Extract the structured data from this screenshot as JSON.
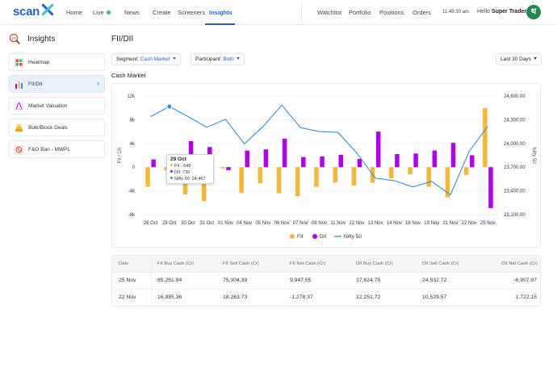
{
  "nav": {
    "logo": "scan",
    "items": [
      "Home",
      "Live",
      "News",
      "Create",
      "Screeners",
      "Insights"
    ],
    "right_items": [
      "Watchlist",
      "Portfolio",
      "Positions",
      "Orders"
    ],
    "time": "11:49:30 am",
    "hello_prefix": "Hello",
    "user_name": "Super Trader",
    "avatar_letter": "थ",
    "accent_color": "#1f62d6",
    "live_color": "#3cc36b"
  },
  "sidebar": {
    "title": "Insights",
    "items": [
      {
        "label": "Heatmap",
        "icon": "heatmap-icon"
      },
      {
        "label": "FII/DII",
        "icon": "bar-chart-icon"
      },
      {
        "label": "Market Valuation",
        "icon": "valuation-curve-icon"
      },
      {
        "label": "Bulk/Block Deals",
        "icon": "stacked-coins-icon"
      },
      {
        "label": "F&O Ban - MWPL",
        "icon": "ban-icon"
      }
    ]
  },
  "main": {
    "title": "FII/DII",
    "segment_label": "Segment:",
    "segment_value": "Cash Market",
    "participant_label": "Participant:",
    "participant_value": "Both",
    "range_value": "Last 30 Days",
    "section_title": "Cash Market"
  },
  "tooltip": {
    "title": "29 Oct",
    "fii": "FII: -549",
    "dii": "DII: 730",
    "nifty": "Nifty 50: 24,467"
  },
  "chart_data": {
    "type": "bar",
    "categories": [
      "28 Oct",
      "29 Oct",
      "30 Oct",
      "31 Oct",
      "01 Nov",
      "04 Nov",
      "05 Nov",
      "06 Nov",
      "07 Nov",
      "08 Nov",
      "11 Nov",
      "12 Nov",
      "13 Nov",
      "14 Nov",
      "18 Nov",
      "19 Nov",
      "21 Nov",
      "22 Nov",
      "25 Nov"
    ],
    "series": [
      {
        "name": "FII",
        "kind": "bar",
        "axis": "left",
        "color": "#f7b733",
        "values": [
          -3300,
          -549,
          -4600,
          -5700,
          -200,
          -4300,
          -2700,
          -4400,
          -4900,
          -3300,
          -2600,
          -3100,
          -2600,
          -1900,
          -1200,
          -3300,
          -5100,
          -1300,
          9950
        ]
      },
      {
        "name": "DII",
        "kind": "bar",
        "axis": "left",
        "color": "#b500f0",
        "values": [
          1300,
          730,
          4400,
          3400,
          -500,
          2800,
          3000,
          4800,
          1700,
          1800,
          2100,
          1400,
          6000,
          2200,
          2300,
          2800,
          4100,
          2000,
          -6900
        ]
      },
      {
        "name": "Nifty 50",
        "kind": "line",
        "axis": "right",
        "color": "#2f8fe0",
        "values": [
          24340,
          24467,
          24340,
          24205,
          24305,
          23995,
          24215,
          24485,
          24200,
          24150,
          24140,
          23880,
          23560,
          23530,
          23450,
          23520,
          23350,
          23900,
          24220
        ]
      }
    ],
    "left_axis": {
      "label": "FII / DII",
      "range": [
        -8000,
        12000
      ],
      "ticks": [
        "-8k",
        "-4k",
        "0",
        "4k",
        "8k",
        "12k"
      ]
    },
    "right_axis": {
      "label": "Nifty 50",
      "range": [
        23100,
        24600
      ],
      "ticks": [
        "23,100.00",
        "23,400.00",
        "23,700.00",
        "24,000.00",
        "24,300.00",
        "24,600.00"
      ]
    },
    "legend": [
      "FII",
      "DII",
      "Nifty 50"
    ],
    "legend_position": "bottom",
    "grid": true,
    "highlight_index": 1
  },
  "table": {
    "headers": [
      "Date",
      "FII Buy Cash (Cr)",
      "FII Sell Cash (Cr)",
      "FII Net Cash (Cr)",
      "DII Buy Cash (Cr)",
      "DII Sell Cash (Cr)",
      "DII Net Cash (Cr)"
    ],
    "rows": [
      [
        "25 Nov",
        "85,251.94",
        "75,304.39",
        "9,947.55",
        "17,624.75",
        "24,532.72",
        "-6,907.97"
      ],
      [
        "22 Nov",
        "16,985.36",
        "18,263.73",
        "-1,278.37",
        "12,251.72",
        "10,529.57",
        "1,722.15"
      ]
    ]
  }
}
